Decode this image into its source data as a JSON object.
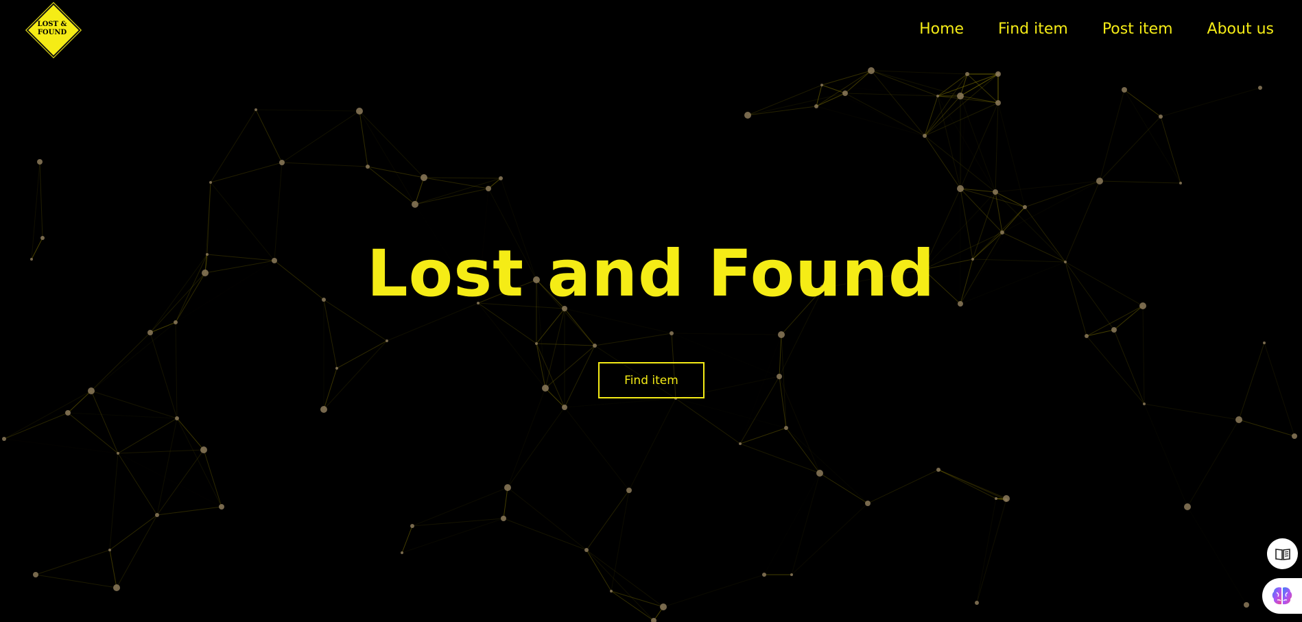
{
  "logo": {
    "line1": "LOST &",
    "line2": "FOUND"
  },
  "nav": {
    "items": [
      "Home",
      "Find item",
      "Post item",
      "About us"
    ]
  },
  "hero": {
    "title": "Lost and Found",
    "button": "Find item"
  },
  "colors": {
    "accent": "#f5ec16",
    "background": "#000000",
    "node": "#8c7a5a"
  },
  "icons": {
    "reader": "book-open-icon",
    "assistant": "brain-icon"
  }
}
